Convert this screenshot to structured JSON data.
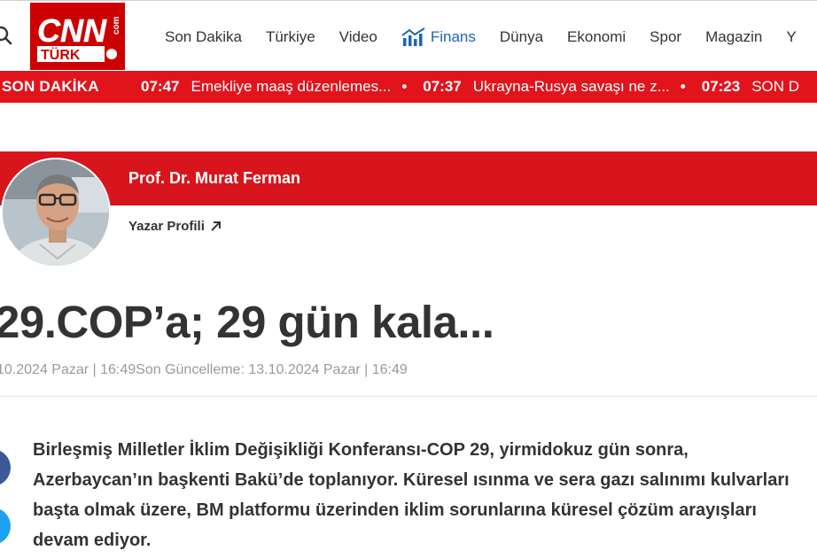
{
  "header": {
    "logo_text": "CNN TÜRK .com",
    "nav": [
      {
        "label": "Son Dakika"
      },
      {
        "label": "Türkiye"
      },
      {
        "label": "Video"
      },
      {
        "label": "Finans"
      },
      {
        "label": "Dünya"
      },
      {
        "label": "Ekonomi"
      },
      {
        "label": "Spor"
      },
      {
        "label": "Magazin"
      },
      {
        "label": "Y"
      }
    ]
  },
  "breaking": {
    "label": "SON DAKİKA",
    "items": [
      {
        "time": "07:47",
        "text": "Emekliye maaş düzenlemes..."
      },
      {
        "time": "07:37",
        "text": "Ukrayna-Rusya savaşı ne z..."
      },
      {
        "time": "07:23",
        "text": "SON D"
      }
    ],
    "separator": "•"
  },
  "author": {
    "name": "Prof. Dr. Murat Ferman",
    "profile_link": "Yazar Profili"
  },
  "article": {
    "title": "29.COP’a; 29 gün kala...",
    "meta": "10.2024 Pazar | 16:49Son Güncelleme: 13.10.2024 Pazar | 16:49",
    "lead": "Birleşmiş Milletler İklim Değişikliği Konferansı-COP 29, yirmidokuz gün sonra, Azerbaycan’ın başkenti Bakü’de toplanıyor. Küresel ısınma ve sera gazı salınımı kulvarları başta olmak üzere, BM platformu üzerinden iklim sorunlarına küresel çözüm arayışları devam ediyor."
  },
  "colors": {
    "brand_red": "#e1141c",
    "author_band": "#d8141c",
    "finans_blue": "#1e64b0",
    "facebook": "#3b5998",
    "twitter": "#1da1f2"
  }
}
